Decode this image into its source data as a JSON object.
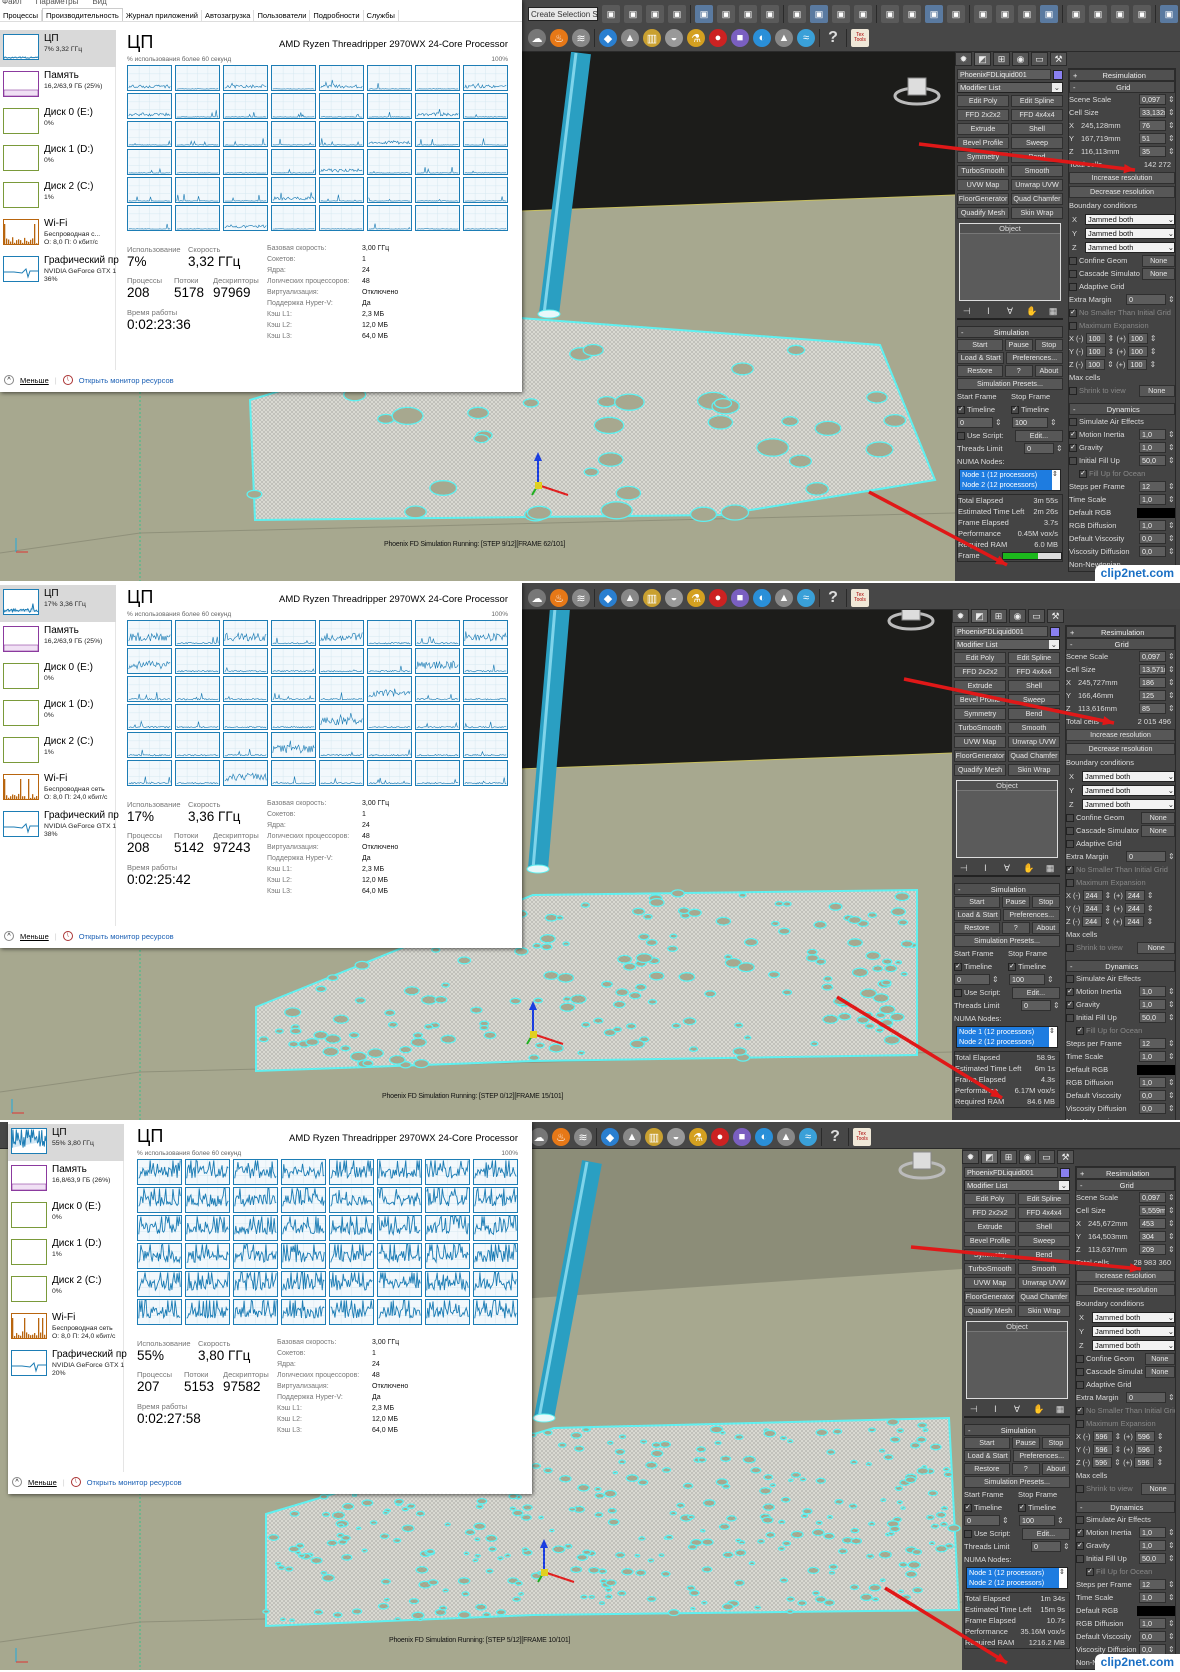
{
  "toolbar": {
    "selection_set": "Create Selection Se",
    "help": "?",
    "textools": "Tex Tools"
  },
  "tm": {
    "menu": [
      "Файл",
      "Параметры",
      "Вид"
    ],
    "tabs": [
      "Процессы",
      "Производительность",
      "Журнал приложений",
      "Автозагрузка",
      "Пользователи",
      "Подробности",
      "Службы"
    ],
    "sidebar": {
      "cpu": "ЦП",
      "memory": "Память",
      "disk0": "Диск 0 (E:)",
      "disk1": "Диск 1 (D:)",
      "disk2": "Диск 2 (C:)",
      "wifi": "Wi-Fi",
      "gpu": "Графический пр"
    },
    "title": "ЦП",
    "cpu_name": "AMD Ryzen Threadripper 2970WX 24-Core Processor",
    "graph_caption": "% использования более 60 секунд",
    "graph_max": "100%",
    "labels": {
      "usage": "Использование",
      "speed": "Скорость",
      "processes": "Процессы",
      "threads": "Потоки",
      "handles": "Дескрипторы",
      "uptime": "Время работы"
    },
    "specs": [
      {
        "label": "Базовая скорость:",
        "value": "3,00 ГГц"
      },
      {
        "label": "Сокетов:",
        "value": "1"
      },
      {
        "label": "Ядра:",
        "value": "24"
      },
      {
        "label": "Логических процессоров:",
        "value": "48"
      },
      {
        "label": "Виртуализация:",
        "value": "Отключено"
      },
      {
        "label": "Поддержка Hyper-V:",
        "value": "Да"
      },
      {
        "label": "Кэш L1:",
        "value": "2,3 МБ"
      },
      {
        "label": "Кэш L2:",
        "value": "12,0 МБ"
      },
      {
        "label": "Кэш L3:",
        "value": "64,0 МБ"
      }
    ],
    "fewer": "Меньше",
    "open_monitor": "Открыть монитор ресурсов"
  },
  "max": {
    "object_name": "PhoenixFDLiquid001",
    "modifier_list": "Modifier List",
    "modifiers": [
      [
        "Edit Poly",
        "Edit Spline"
      ],
      [
        "FFD 2x2x2",
        "FFD 4x4x4"
      ],
      [
        "Extrude",
        "Shell"
      ],
      [
        "Bevel Profile",
        "Sweep"
      ],
      [
        "Symmetry",
        "Bend"
      ],
      [
        "TurboSmooth",
        "Smooth"
      ],
      [
        "UVW Map",
        "Unwrap UVW"
      ],
      [
        "FloorGenerator",
        "Quad Chamfer"
      ],
      [
        "Quadify Mesh",
        "Skin Wrap"
      ]
    ],
    "object_header": "Object",
    "sim": {
      "title": "Simulation",
      "start": "Start",
      "pause": "Pause",
      "stop": "Stop",
      "load_start": "Load & Start",
      "preferences": "Preferences...",
      "restore": "Restore",
      "help": "?",
      "about": "About",
      "presets": "Simulation Presets...",
      "start_frame": "Start Frame",
      "stop_frame": "Stop Frame",
      "timeline": "Timeline",
      "start_value": "0",
      "stop_value": "100",
      "use_script": "Use Script:",
      "edit": "Edit...",
      "threads_limit": "Threads Limit",
      "threads_value": "0",
      "numa": "NUMA Nodes:",
      "nodes": [
        "Node 1 (12 processors)",
        "Node 2 (12 processors)"
      ],
      "total_elapsed": "Total Elapsed",
      "time_left": "Estimated Time Left",
      "frame_elapsed": "Frame Elapsed",
      "performance": "Performance",
      "required_ram": "Required RAM",
      "frame": "Frame"
    },
    "resim": {
      "resimulation": "Resimulation",
      "grid": "Grid",
      "scene_scale": "Scene Scale",
      "scene_scale_value": "0,097",
      "cell_size": "Cell Size",
      "axes": [
        "X",
        "Y",
        "Z"
      ],
      "total_cells": "Total cells",
      "increase": "Increase resolution",
      "decrease": "Decrease resolution",
      "boundary": "Boundary conditions",
      "jammed": "Jammed both",
      "confine": "Confine Geom",
      "none": "None",
      "cascade": "Cascade Simulator",
      "adaptive": "Adaptive Grid",
      "extra_margin": "Extra Margin",
      "extra_margin_value": "0",
      "no_smaller": "No Smaller Than Initial Grid",
      "max_expansion": "Maximum Expansion",
      "minus": "(-)",
      "plus": "(+)",
      "max_cells": "Max cells",
      "shrink": "Shrink to view"
    },
    "dyn": {
      "title": "Dynamics",
      "air": "Simulate Air Effects",
      "motion": "Motion Inertia",
      "motion_value": "1,0",
      "gravity": "Gravity",
      "gravity_value": "1,0",
      "fill": "Initial Fill Up",
      "fill_value": "50,0",
      "ocean": "Fill Up for Ocean",
      "steps": "Steps per Frame",
      "steps_value": "12",
      "time_scale": "Time Scale",
      "time_scale_value": "1,0",
      "rgb": "Default RGB",
      "rgb_color": "#000000",
      "rgb_diff": "RGB Diffusion",
      "rgb_diff_value": "1,0",
      "visc": "Default Viscosity",
      "visc_value": "0,0",
      "visc_diff": "Viscosity Diffusion",
      "visc_diff_value": "0,0",
      "non_newtonian": "Non-Newtonian"
    }
  },
  "watermark": "clip2net.com",
  "colors": {
    "arrow": "#e01818",
    "cpu_graph": "#1d7db5",
    "liquid_outline": "#5ff0f0",
    "pipe": "#2a9fc2",
    "floor": "#a7a88f",
    "numa_selected": "#1e7ce0"
  },
  "panels": [
    {
      "tm": {
        "cpu_sub": "7% 3,32 ГГц",
        "memory_sub": "16,2/63,9 ГБ (25%)",
        "disk0_sub": "0%",
        "disk1_sub": "0%",
        "disk2_sub": "1%",
        "wifi_sub1": "Беспроводная с...",
        "wifi_sub2": "О: 8,0 П: 0 кбит/с",
        "gpu_sub1": "NVIDIA GeForce GTX 1",
        "gpu_sub2": "36%",
        "usage": "7%",
        "speed": "3,32 ГГц",
        "processes": "208",
        "threads": "5178",
        "handles": "97969",
        "uptime": "0:02:23:36",
        "cpu_load": 7
      },
      "max": {
        "cell_size": "33,132m",
        "dims": [
          {
            "size": "245,128mm",
            "cells": "76"
          },
          {
            "size": "167,719mm",
            "cells": "51"
          },
          {
            "size": "116,113mm",
            "cells": "35"
          }
        ],
        "total_cells": "142 272",
        "expansion": "100",
        "total_elapsed": "3m 55s",
        "time_left": "2m 26s",
        "frame_elapsed": "3.7s",
        "performance": "0.45M vox/s",
        "required_ram": "6.0 MB",
        "frame_progress": 0.6
      },
      "status": "Phoenix FD Simulation Running: [STEP 9/12][FRAME 62/101]"
    },
    {
      "tm": {
        "cpu_sub": "17% 3,36 ГГц",
        "memory_sub": "16,2/63,9 ГБ (25%)",
        "disk0_sub": "0%",
        "disk1_sub": "0%",
        "disk2_sub": "1%",
        "wifi_sub1": "Беспроводная сеть",
        "wifi_sub2": "О: 8,0 П: 24,0 кбит/с",
        "gpu_sub1": "NVIDIA GeForce GTX 1",
        "gpu_sub2": "38%",
        "usage": "17%",
        "speed": "3,36 ГГц",
        "processes": "208",
        "threads": "5142",
        "handles": "97243",
        "uptime": "0:02:25:42",
        "cpu_load": 17
      },
      "max": {
        "cell_size": "13,571m",
        "dims": [
          {
            "size": "245,727mm",
            "cells": "186"
          },
          {
            "size": "166,46mm",
            "cells": "125"
          },
          {
            "size": "113,616mm",
            "cells": "85"
          }
        ],
        "total_cells": "2 015 496",
        "expansion": "244",
        "total_elapsed": "58.9s",
        "time_left": "6m 1s",
        "frame_elapsed": "4.3s",
        "performance": "6.17M vox/s",
        "required_ram": "84.6 MB"
      },
      "status": "Phoenix FD Simulation Running: [STEP 0/12][FRAME 15/101]"
    },
    {
      "tm": {
        "cpu_sub": "55% 3,80 ГГц",
        "memory_sub": "16,8/63,9 ГБ (26%)",
        "disk0_sub": "0%",
        "disk1_sub": "1%",
        "disk2_sub": "0%",
        "wifi_sub1": "Беспроводная сеть",
        "wifi_sub2": "О: 8,0 П: 24,0 кбит/с",
        "gpu_sub1": "NVIDIA GeForce GTX 1",
        "gpu_sub2": "20%",
        "usage": "55%",
        "speed": "3,80 ГГц",
        "processes": "207",
        "threads": "5153",
        "handles": "97582",
        "uptime": "0:02:27:58",
        "cpu_load": 55
      },
      "max": {
        "cell_size": "5,559m",
        "dims": [
          {
            "size": "245,672mm",
            "cells": "453"
          },
          {
            "size": "164,503mm",
            "cells": "304"
          },
          {
            "size": "113,637mm",
            "cells": "209"
          }
        ],
        "total_cells": "28 983 360",
        "expansion": "596",
        "total_elapsed": "1m 34s",
        "time_left": "15m 9s",
        "frame_elapsed": "10.7s",
        "performance": "35.16M vox/s",
        "required_ram": "1216.2 MB"
      },
      "status": "Phoenix FD Simulation Running: [STEP 5/12][FRAME 10/101]"
    }
  ]
}
